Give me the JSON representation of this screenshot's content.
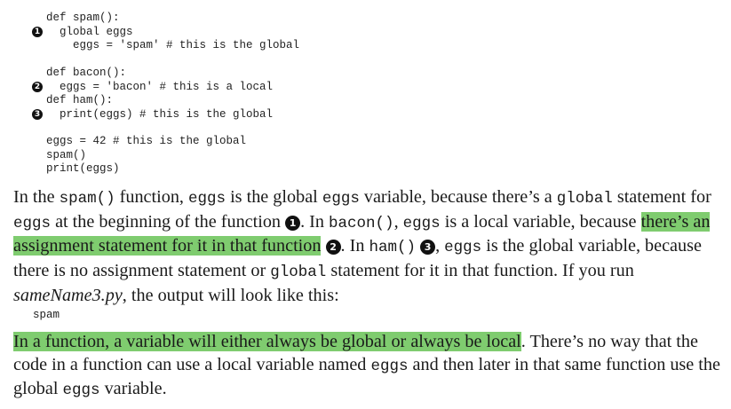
{
  "code": {
    "block1": [
      "def spam():",
      "  global eggs",
      "    eggs = 'spam' # this is the global"
    ],
    "block2": [
      "def bacon():",
      "  eggs = 'bacon' # this is a local",
      "def ham():",
      "  print(eggs) # this is the global"
    ],
    "block3": [
      "eggs = 42 # this is the global",
      "spam()",
      "print(eggs)"
    ],
    "markers": [
      "1",
      "2",
      "3"
    ]
  },
  "para1": {
    "t1": "In the ",
    "c1": "spam()",
    "t2": " function, ",
    "c2": "eggs",
    "t3": " is the global ",
    "c3": "eggs",
    "t4": " variable, because there’s a ",
    "c4": "global",
    "t5": " statement for ",
    "c5": "eggs",
    "t6": " at the beginning of the function ",
    "m1": "1",
    "t7": ". In ",
    "c6": "bacon()",
    "t8": ", ",
    "c7": "eggs",
    "t9": " is a local variable, because ",
    "hl": "there’s an assignment statement for it in that function",
    "t10": " ",
    "m2": "2",
    "t11": ". In ",
    "c8": "ham()",
    "t12": " ",
    "m3": "3",
    "t13": ", ",
    "c9": "eggs",
    "t14": " is the global variable, because there is no assignment statement or ",
    "c10": "global",
    "t15": " statement for it in that function. If you run ",
    "filename": "sameName3.py",
    "t16": ", the output will look like this:"
  },
  "output": "spam",
  "para2": {
    "hl": "In a function, a variable will either always be global or always be local",
    "t1": ". There’s no way that the code in a function can use a local variable named ",
    "c1": "eggs",
    "t2": " and then later in that same function use the global ",
    "c2": "eggs",
    "t3": " variable."
  }
}
